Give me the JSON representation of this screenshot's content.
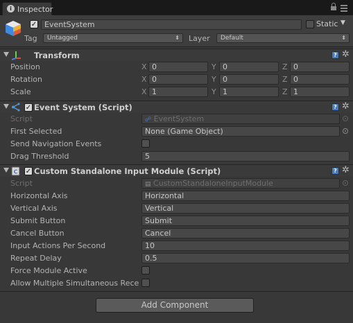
{
  "tab": {
    "title": "Inspector"
  },
  "gameobject": {
    "name": "EventSystem",
    "static_label": "Static",
    "tag_label": "Tag",
    "tag_value": "Untagged",
    "layer_label": "Layer",
    "layer_value": "Default"
  },
  "transform": {
    "title": "Transform",
    "rows": [
      {
        "label": "Position",
        "x": "0",
        "y": "0",
        "z": "0"
      },
      {
        "label": "Rotation",
        "x": "0",
        "y": "0",
        "z": "0"
      },
      {
        "label": "Scale",
        "x": "1",
        "y": "1",
        "z": "1"
      }
    ],
    "axis_x": "X",
    "axis_y": "Y",
    "axis_z": "Z"
  },
  "event_system": {
    "title": "Event System (Script)",
    "script_label": "Script",
    "script_value": "EventSystem",
    "first_selected_label": "First Selected",
    "first_selected_value": "None (Game Object)",
    "send_nav_label": "Send Navigation Events",
    "drag_threshold_label": "Drag Threshold",
    "drag_threshold_value": "5"
  },
  "input_module": {
    "title": "Custom Standalone Input Module (Script)",
    "script_label": "Script",
    "script_value": "CustomStandaloneInputModule",
    "horizontal_axis_label": "Horizontal Axis",
    "horizontal_axis_value": "Horizontal",
    "vertical_axis_label": "Vertical Axis",
    "vertical_axis_value": "Vertical",
    "submit_button_label": "Submit Button",
    "submit_button_value": "Submit",
    "cancel_button_label": "Cancel Button",
    "cancel_button_value": "Cancel",
    "input_actions_label": "Input Actions Per Second",
    "input_actions_value": "10",
    "repeat_delay_label": "Repeat Delay",
    "repeat_delay_value": "0.5",
    "force_module_label": "Force Module Active",
    "allow_multiple_label": "Allow Multiple Simultaneous Rece"
  },
  "add_component_label": "Add Component",
  "icons": {
    "help": "?",
    "gear": "✲",
    "check": "✓"
  },
  "colors": {
    "background": "#383838",
    "tab_bar": "#191919",
    "help_blue": "#4a7ac4"
  }
}
